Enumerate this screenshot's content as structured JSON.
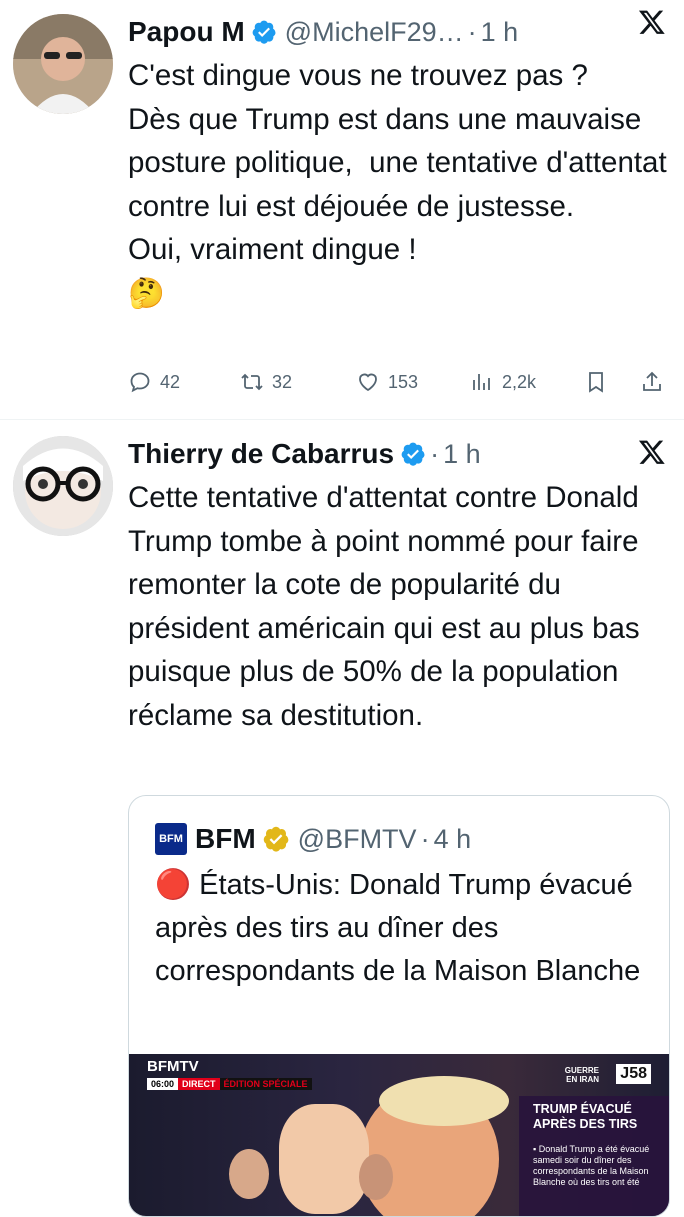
{
  "tweets": [
    {
      "name": "Papou M",
      "handle": "@MichelF29…",
      "time": "1 h",
      "text": "C'est dingue vous ne trouvez pas ?\nDès que Trump est dans une mauvaise posture politique,  une tentative d'attentat contre lui est déjouée de justesse.\nOui, vraiment dingue !\n🤔",
      "replies": "42",
      "retweets": "32",
      "likes": "153",
      "views": "2,2k"
    },
    {
      "name": "Thierry de Cabarrus",
      "time": "1 h",
      "text": "Cette tentative d'attentat contre Donald Trump tombe à point nommé pour faire remonter la cote de popularité du président américain qui est au plus bas puisque plus de 50% de la population réclame sa destitution."
    }
  ],
  "quote": {
    "logo": "BFM",
    "name": "BFM",
    "handle": "@BFMTV",
    "time": "4 h",
    "text": "🔴 États-Unis: Donald Trump évacué après des tirs au dîner des correspondants de la Maison Blanche",
    "image": {
      "channel": "BFMTV",
      "clock": "06:00",
      "direct": "DIRECT",
      "edition": "ÉDITION SPÉCIALE",
      "banner_line1": "GUERRE",
      "banner_line2": "EN IRAN",
      "day": "J58",
      "headline": "TRUMP ÉVACUÉ APRÈS DES TIRS",
      "bullet": "▪ Donald Trump a été évacué samedi soir du dîner des correspondants de la Maison Blanche où des tirs ont été"
    }
  },
  "colors": {
    "verified_blue": "#1d9bf0",
    "verified_gold": "#e2b719",
    "muted": "#536471"
  }
}
